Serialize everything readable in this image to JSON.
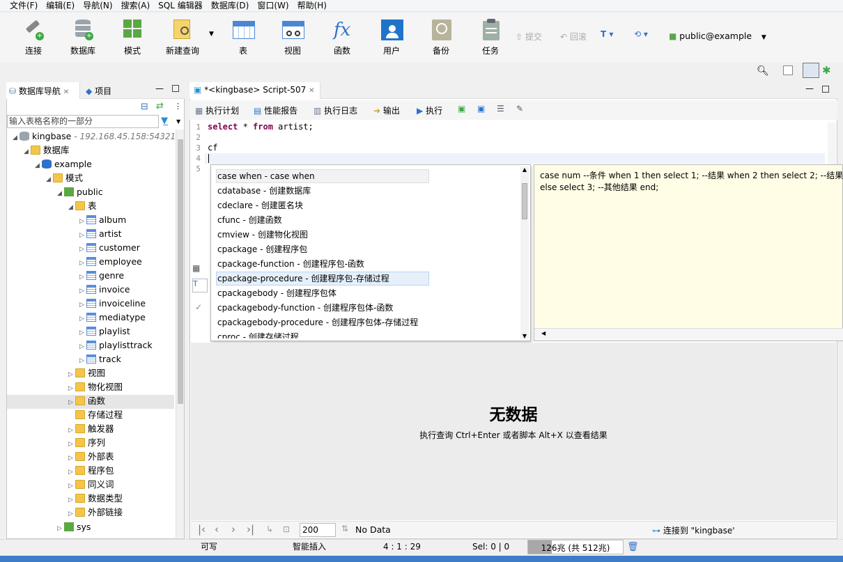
{
  "menu": [
    "文件(F)",
    "编辑(E)",
    "导航(N)",
    "搜索(A)",
    "SQL 编辑器",
    "数据库(D)",
    "窗口(W)",
    "帮助(H)"
  ],
  "toolbar": {
    "buttons": [
      "连接",
      "数据库",
      "模式",
      "新建查询",
      "表",
      "视图",
      "函数",
      "用户",
      "备份",
      "任务"
    ],
    "commit": "提交",
    "rollback": "回滚",
    "connection": "public@example"
  },
  "nav": {
    "tab_db": "数据库导航",
    "tab_project": "项目",
    "filter_placeholder": "输入表格名称的一部分",
    "conn_name": "kingbase",
    "conn_host": "- 192.168.45.158:54321",
    "databases": "数据库",
    "example": "example",
    "schemas": "模式",
    "public": "public",
    "tables": "表",
    "table_items": [
      "album",
      "artist",
      "customer",
      "employee",
      "genre",
      "invoice",
      "invoiceline",
      "mediatype",
      "playlist",
      "playlisttrack",
      "track"
    ],
    "folders": [
      "视图",
      "物化视图",
      "函数",
      "存储过程",
      "触发器",
      "序列",
      "外部表",
      "程序包",
      "同义词",
      "数据类型",
      "外部链接"
    ],
    "sys": "sys"
  },
  "editor": {
    "tab_title": "*<kingbase> Script-507",
    "actions": [
      "执行计划",
      "性能报告",
      "执行日志",
      "输出",
      "执行"
    ],
    "line_numbers": [
      "1",
      "2",
      "3",
      "4",
      "5"
    ],
    "line1_kw1": "select",
    "line1_mid": " * ",
    "line1_kw2": "from",
    "line1_rest": " artist;",
    "line3": "cf"
  },
  "autocomplete": {
    "items": [
      "case when  -  case when",
      "cdatabase  -  创建数据库",
      "cdeclare  -  创建匿名块",
      "cfunc  -  创建函数",
      "cmview  -  创建物化视图",
      "cpackage  -  创建程序包",
      "cpackage-function  -  创建程序包-函数",
      "cpackage-procedure  -  创建程序包-存储过程",
      "cpackagebody  -  创建程序包体",
      "cpackagebody-function  -  创建程序包体-函数",
      "cpackagebody-procedure  -  创建程序包体-存储过程",
      "cproc  -  创建存储过程"
    ],
    "preview_line1": "case num --条件 when 1 then select 1; --结果 when 2 then select 2; --结果",
    "preview_line2": " else select 3; --其他结果 end;"
  },
  "results": {
    "no_data_title": "无数据",
    "no_data_hint": "执行查询 Ctrl+Enter 或者脚本 Alt+X 以查看结果",
    "fetch_size": "200",
    "no_data_label": "No Data",
    "connected": "连接到 \"kingbase'"
  },
  "status": {
    "writable": "可写",
    "insert_mode": "智能插入",
    "position": "4 : 1 : 29",
    "selection": "Sel: 0 | 0",
    "memory": "126兆 (共 512兆)"
  },
  "colors": {
    "accent": "#3b7dd8",
    "folder": "#f3c64b",
    "keyword": "#7f0055",
    "preview_bg": "#fffde6"
  }
}
